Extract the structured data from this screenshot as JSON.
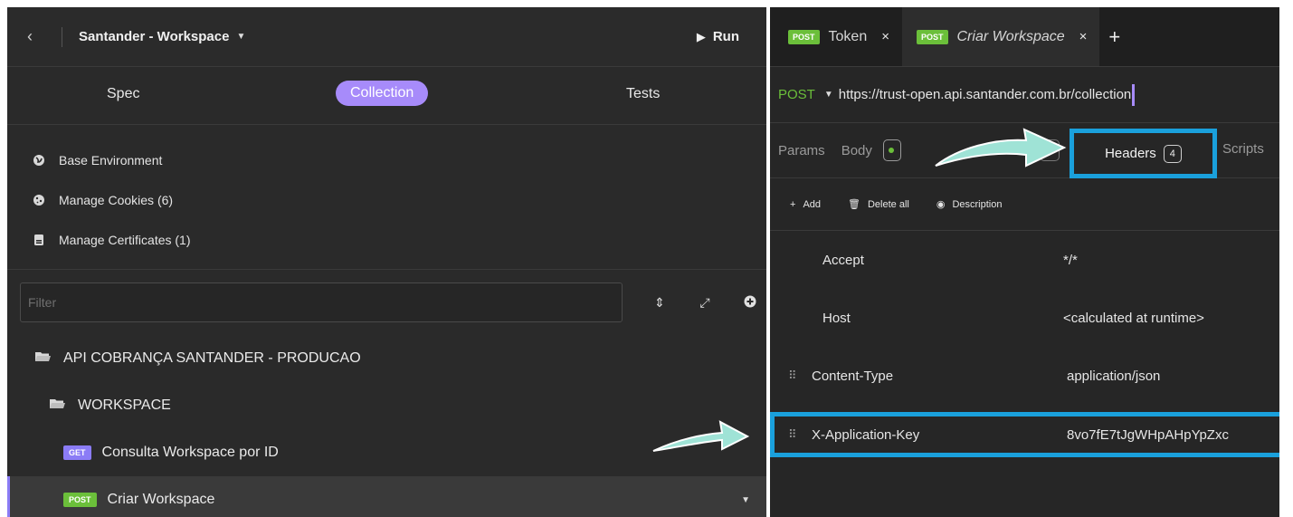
{
  "left": {
    "back_icon": "chevron-left-icon",
    "workspace_title": "Santander - Workspace",
    "run_label": "Run",
    "subtabs": {
      "spec": "Spec",
      "collection": "Collection",
      "tests": "Tests"
    },
    "env_items": [
      {
        "label": "Base Environment",
        "icon": "globe-icon"
      },
      {
        "label": "Manage Cookies (6)",
        "icon": "cookie-icon"
      },
      {
        "label": "Manage Certificates (1)",
        "icon": "certificate-icon"
      }
    ],
    "filter_placeholder": "Filter",
    "tree": {
      "root": "API COBRANÇA SANTANDER - PRODUCAO",
      "folder": "WORKSPACE",
      "requests": [
        {
          "method": "GET",
          "name": "Consulta Workspace por ID"
        },
        {
          "method": "POST",
          "name": "Criar Workspace"
        }
      ]
    }
  },
  "right": {
    "tabs": [
      {
        "method": "POST",
        "title": "Token",
        "close": "×"
      },
      {
        "method": "POST",
        "title": "Criar Workspace",
        "close": "×"
      }
    ],
    "new_tab": "+",
    "method": "POST",
    "url": "https://trust-open.api.santander.com.br/collection",
    "reqtabs": {
      "params": "Params",
      "body": "Body",
      "headers": "Headers",
      "headers_count": "4",
      "scripts": "Scripts"
    },
    "actions": {
      "add": "Add",
      "delete_all": "Delete all",
      "description": "Description"
    },
    "headers": [
      {
        "key": "Accept",
        "value": "*/*"
      },
      {
        "key": "Host",
        "value": "<calculated at runtime>"
      },
      {
        "key": "Content-Type",
        "value": "application/json"
      },
      {
        "key": "X-Application-Key",
        "value": "8vo7fE7tJgWHpAHpYpZxc"
      }
    ]
  },
  "colors": {
    "accent_purple": "#a78bfa",
    "post_green": "#6bbf3a",
    "highlight_blue": "#1aa0dc",
    "arrow_teal": "#9fe3d6"
  }
}
